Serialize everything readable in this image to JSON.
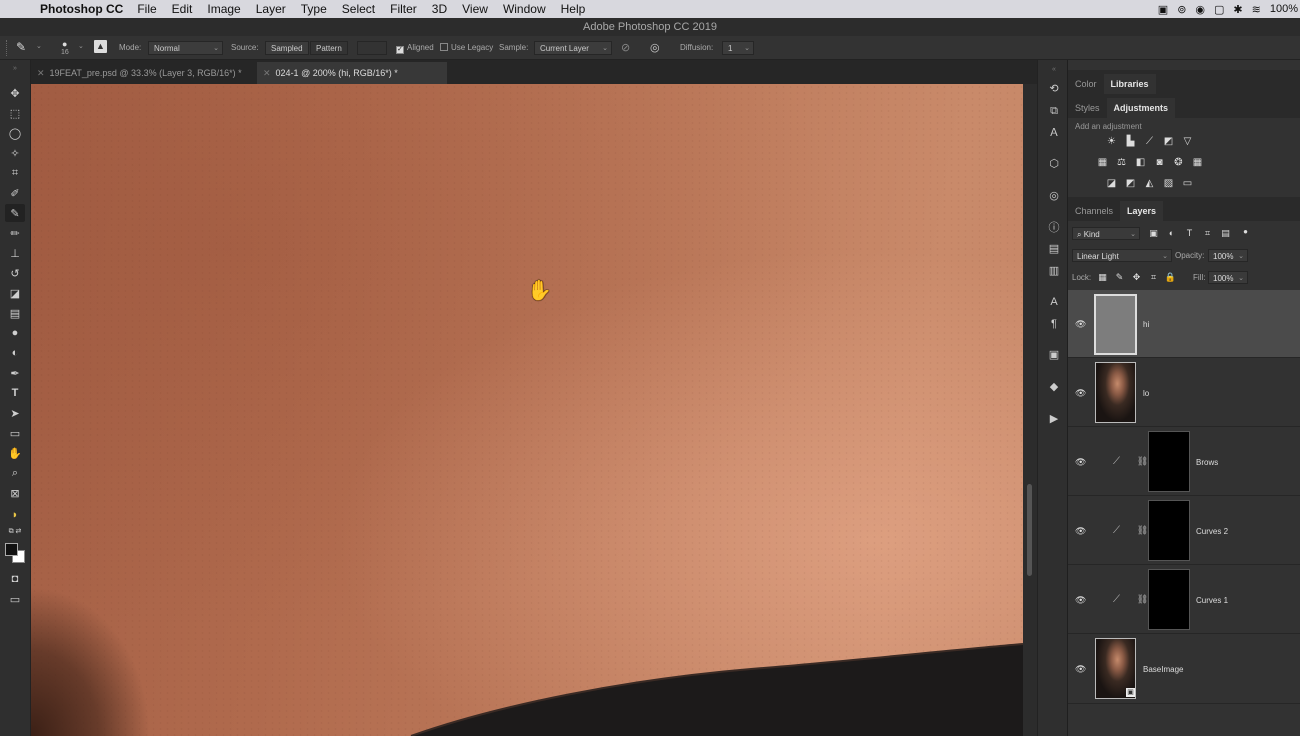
{
  "menubar": {
    "app_name": "Photoshop CC",
    "items": [
      "File",
      "Edit",
      "Image",
      "Layer",
      "Type",
      "Select",
      "Filter",
      "3D",
      "View",
      "Window",
      "Help"
    ],
    "battery": "100%"
  },
  "window_title": "Adobe Photoshop CC 2019",
  "options_bar": {
    "brush_size": "16",
    "mode_label": "Mode:",
    "mode_value": "Normal",
    "source_label": "Source:",
    "source_sampled": "Sampled",
    "source_pattern": "Pattern",
    "aligned_label": "Aligned",
    "aligned_checked": true,
    "use_legacy_label": "Use Legacy",
    "use_legacy_checked": false,
    "sample_label": "Sample:",
    "sample_value": "Current Layer",
    "diffusion_label": "Diffusion:",
    "diffusion_value": "1"
  },
  "document_tabs": [
    {
      "title": "19FEAT_pre.psd @ 33.3% (Layer 3, RGB/16*) *",
      "active": false
    },
    {
      "title": "024-1 @ 200% (hi, RGB/16*) *",
      "active": true
    }
  ],
  "panel_top": {
    "tabs_row1": [
      {
        "label": "Color",
        "active": false
      },
      {
        "label": "Libraries",
        "active": true
      }
    ],
    "tabs_row2": [
      {
        "label": "Styles",
        "active": false
      },
      {
        "label": "Adjustments",
        "active": true
      }
    ],
    "add_adjustment": "Add an adjustment"
  },
  "layers_panel": {
    "tabs": [
      {
        "label": "Channels",
        "active": false
      },
      {
        "label": "Layers",
        "active": true
      }
    ],
    "filter_kind": "Kind",
    "blend_mode": "Linear Light",
    "opacity_label": "Opacity:",
    "opacity_value": "100%",
    "lock_label": "Lock:",
    "fill_label": "Fill:",
    "fill_value": "100%",
    "layers": [
      {
        "name": "hi",
        "type": "gray",
        "selected": true
      },
      {
        "name": "lo",
        "type": "photo",
        "selected": false
      },
      {
        "name": "Brows",
        "type": "curves",
        "selected": false
      },
      {
        "name": "Curves 2",
        "type": "curves",
        "selected": false
      },
      {
        "name": "Curves 1",
        "type": "curves",
        "selected": false
      },
      {
        "name": "BaseImage",
        "type": "photo",
        "selected": false
      }
    ]
  }
}
